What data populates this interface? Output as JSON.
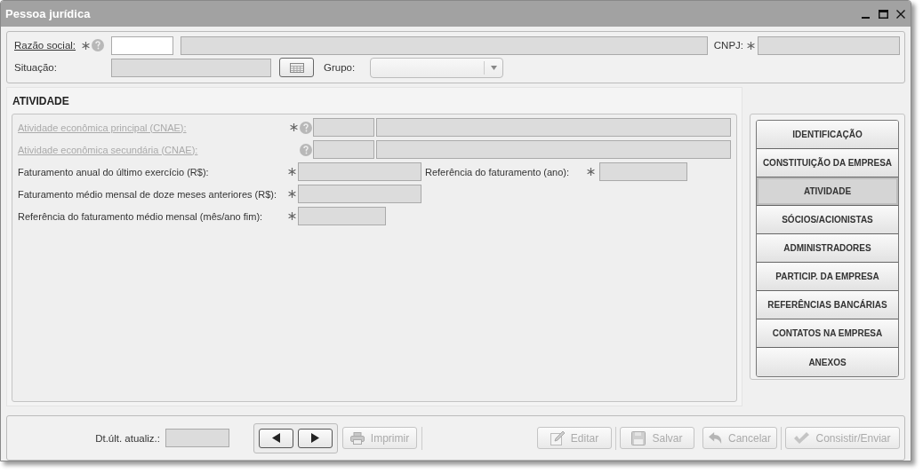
{
  "window": {
    "title": "Pessoa jurídica"
  },
  "header": {
    "razao_social": {
      "label": "Razão social:",
      "required": true,
      "help": true,
      "code_disabled": false
    },
    "cnpj": {
      "label": "CNPJ:",
      "required": true
    },
    "situacao": {
      "label": "Situação:"
    },
    "grupo": {
      "label": "Grupo:"
    }
  },
  "section": {
    "title": "ATIVIDADE",
    "rows": [
      {
        "kind": "code",
        "label": "Atividade econômica principal (CNAE):",
        "disabled": true,
        "required": true,
        "help": true
      },
      {
        "kind": "code",
        "label": "Atividade econômica secundária (CNAE):",
        "disabled": true,
        "required": false,
        "help": true
      },
      {
        "kind": "wide",
        "label": "Faturamento anual do último exercício (R$):",
        "disabled": false,
        "required": true,
        "help": false,
        "extra": {
          "label": "Referência do faturamento (ano):",
          "required": true
        }
      },
      {
        "kind": "wide",
        "label": "Faturamento médio mensal de doze meses anteriores (R$):",
        "disabled": false,
        "required": true,
        "help": false
      },
      {
        "kind": "short",
        "label": "Referência do faturamento médio mensal (mês/ano fim):",
        "disabled": false,
        "required": true,
        "help": false
      }
    ]
  },
  "nav": [
    {
      "label": "IDENTIFICAÇÃO",
      "selected": false
    },
    {
      "label": "CONSTITUIÇÃO DA EMPRESA",
      "selected": false
    },
    {
      "label": "ATIVIDADE",
      "selected": true
    },
    {
      "label": "SÓCIOS/ACIONISTAS",
      "selected": false
    },
    {
      "label": "ADMINISTRADORES",
      "selected": false
    },
    {
      "label": "PARTICIP. DA EMPRESA",
      "selected": false
    },
    {
      "label": "REFERÊNCIAS BANCÁRIAS",
      "selected": false
    },
    {
      "label": "CONTATOS NA EMPRESA",
      "selected": false
    },
    {
      "label": "ANEXOS",
      "selected": false
    }
  ],
  "footer": {
    "date_label": "Dt.últ. atualiz.:",
    "print": {
      "kind": "print",
      "label": "Imprimir",
      "disabled": true
    },
    "groups": [
      [
        {
          "kind": "edit",
          "label": "Editar",
          "disabled": true
        }
      ],
      [
        {
          "kind": "save",
          "label": "Salvar",
          "disabled": true
        },
        {
          "kind": "cancel",
          "label": "Cancelar",
          "disabled": true
        }
      ],
      [
        {
          "kind": "send",
          "label": "Consistir/Enviar",
          "disabled": true
        }
      ]
    ]
  }
}
